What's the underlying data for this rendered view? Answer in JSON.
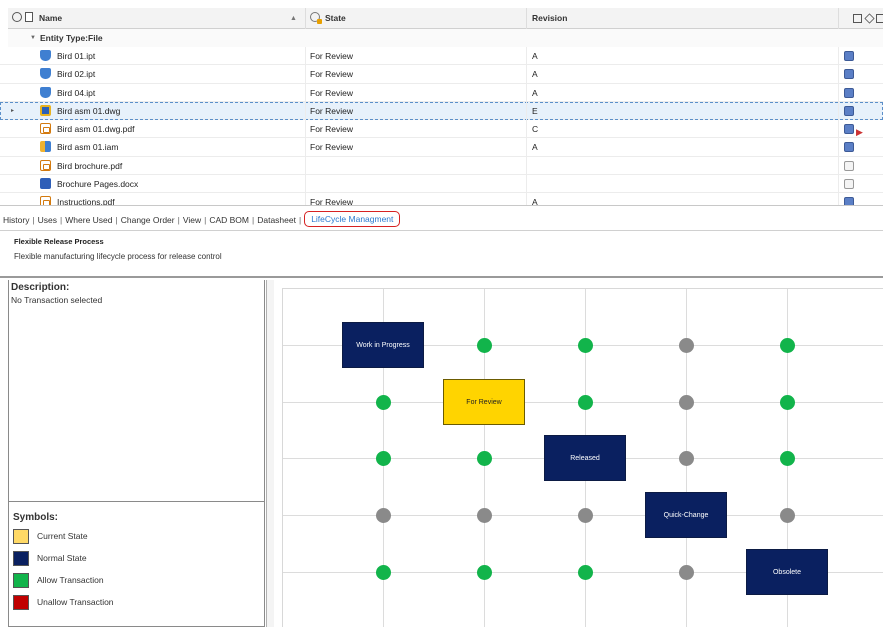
{
  "grid": {
    "columns": {
      "name": "Name",
      "state": "State",
      "revision": "Revision"
    },
    "sort_indicator": "▲",
    "group_label": "Entity Type:File",
    "group_toggle": "▼",
    "row_pointer": "▸",
    "rows": [
      {
        "name": "Bird 01.ipt",
        "state": "For Review",
        "revision": "A",
        "file_icon": "ipt-part-icon",
        "indicator": "blue"
      },
      {
        "name": "Bird 02.ipt",
        "state": "For Review",
        "revision": "A",
        "file_icon": "ipt-part-icon",
        "indicator": "blue"
      },
      {
        "name": "Bird 04.ipt",
        "state": "For Review",
        "revision": "A",
        "file_icon": "ipt-part-icon",
        "indicator": "blue"
      },
      {
        "name": "Bird asm 01.dwg",
        "state": "For Review",
        "revision": "E",
        "file_icon": "dwg-drawing-icon",
        "indicator": "blue",
        "selected": true
      },
      {
        "name": "Bird asm 01.dwg.pdf",
        "state": "For Review",
        "revision": "C",
        "file_icon": "pdf-icon",
        "indicator": "blue",
        "extra_icon": "tag-warning-icon"
      },
      {
        "name": "Bird asm 01.iam",
        "state": "For Review",
        "revision": "A",
        "file_icon": "iam-assembly-icon",
        "indicator": "blue"
      },
      {
        "name": "Bird brochure.pdf",
        "state": "",
        "revision": "",
        "file_icon": "pdf-icon",
        "indicator": "empty"
      },
      {
        "name": "Brochure Pages.docx",
        "state": "",
        "revision": "",
        "file_icon": "docx-icon",
        "indicator": "empty"
      },
      {
        "name": "Instructions.pdf",
        "state": "For Review",
        "revision": "A",
        "file_icon": "pdf-icon",
        "indicator": "blue"
      }
    ]
  },
  "tabs": [
    {
      "label": "History",
      "active": false
    },
    {
      "label": "Uses",
      "active": false
    },
    {
      "label": "Where Used",
      "active": false
    },
    {
      "label": "Change Order",
      "active": false
    },
    {
      "label": "View",
      "active": false
    },
    {
      "label": "CAD BOM",
      "active": false
    },
    {
      "label": "Datasheet",
      "active": false
    },
    {
      "label": "LifeCycle Managment",
      "active": true
    }
  ],
  "tab_separator": "|",
  "process": {
    "title": "Flexible Release Process",
    "description": "Flexible manufacturing lifecycle process for release control"
  },
  "details": {
    "description_label": "Description:",
    "description_value": "No Transaction selected"
  },
  "symbols": {
    "title": "Symbols:",
    "items": [
      {
        "label": "Current State",
        "color": "#ffd966"
      },
      {
        "label": "Normal State",
        "color": "#0a2060"
      },
      {
        "label": "Allow Transaction",
        "color": "#12b44b"
      },
      {
        "label": "Unallow Transaction",
        "color": "#c00000"
      }
    ]
  },
  "lifecycle": {
    "states": [
      {
        "name": "Work in Progress",
        "current": false
      },
      {
        "name": "For Review",
        "current": true
      },
      {
        "name": "Released",
        "current": false
      },
      {
        "name": "Quick-Change",
        "current": false
      },
      {
        "name": "Obsolete",
        "current": false
      }
    ],
    "transition_matrix": [
      [
        "state",
        "allow",
        "allow",
        "gray",
        "allow"
      ],
      [
        "allow",
        "state",
        "allow",
        "gray",
        "allow"
      ],
      [
        "allow",
        "allow",
        "state",
        "gray",
        "allow"
      ],
      [
        "gray",
        "gray",
        "gray",
        "state",
        "gray"
      ],
      [
        "allow",
        "allow",
        "allow",
        "gray",
        "state"
      ]
    ],
    "colors": {
      "allow": "#12b44b",
      "disallowed": "#8a8a8a",
      "normal_state": "#0a2060",
      "current_state": "#ffd400"
    }
  }
}
